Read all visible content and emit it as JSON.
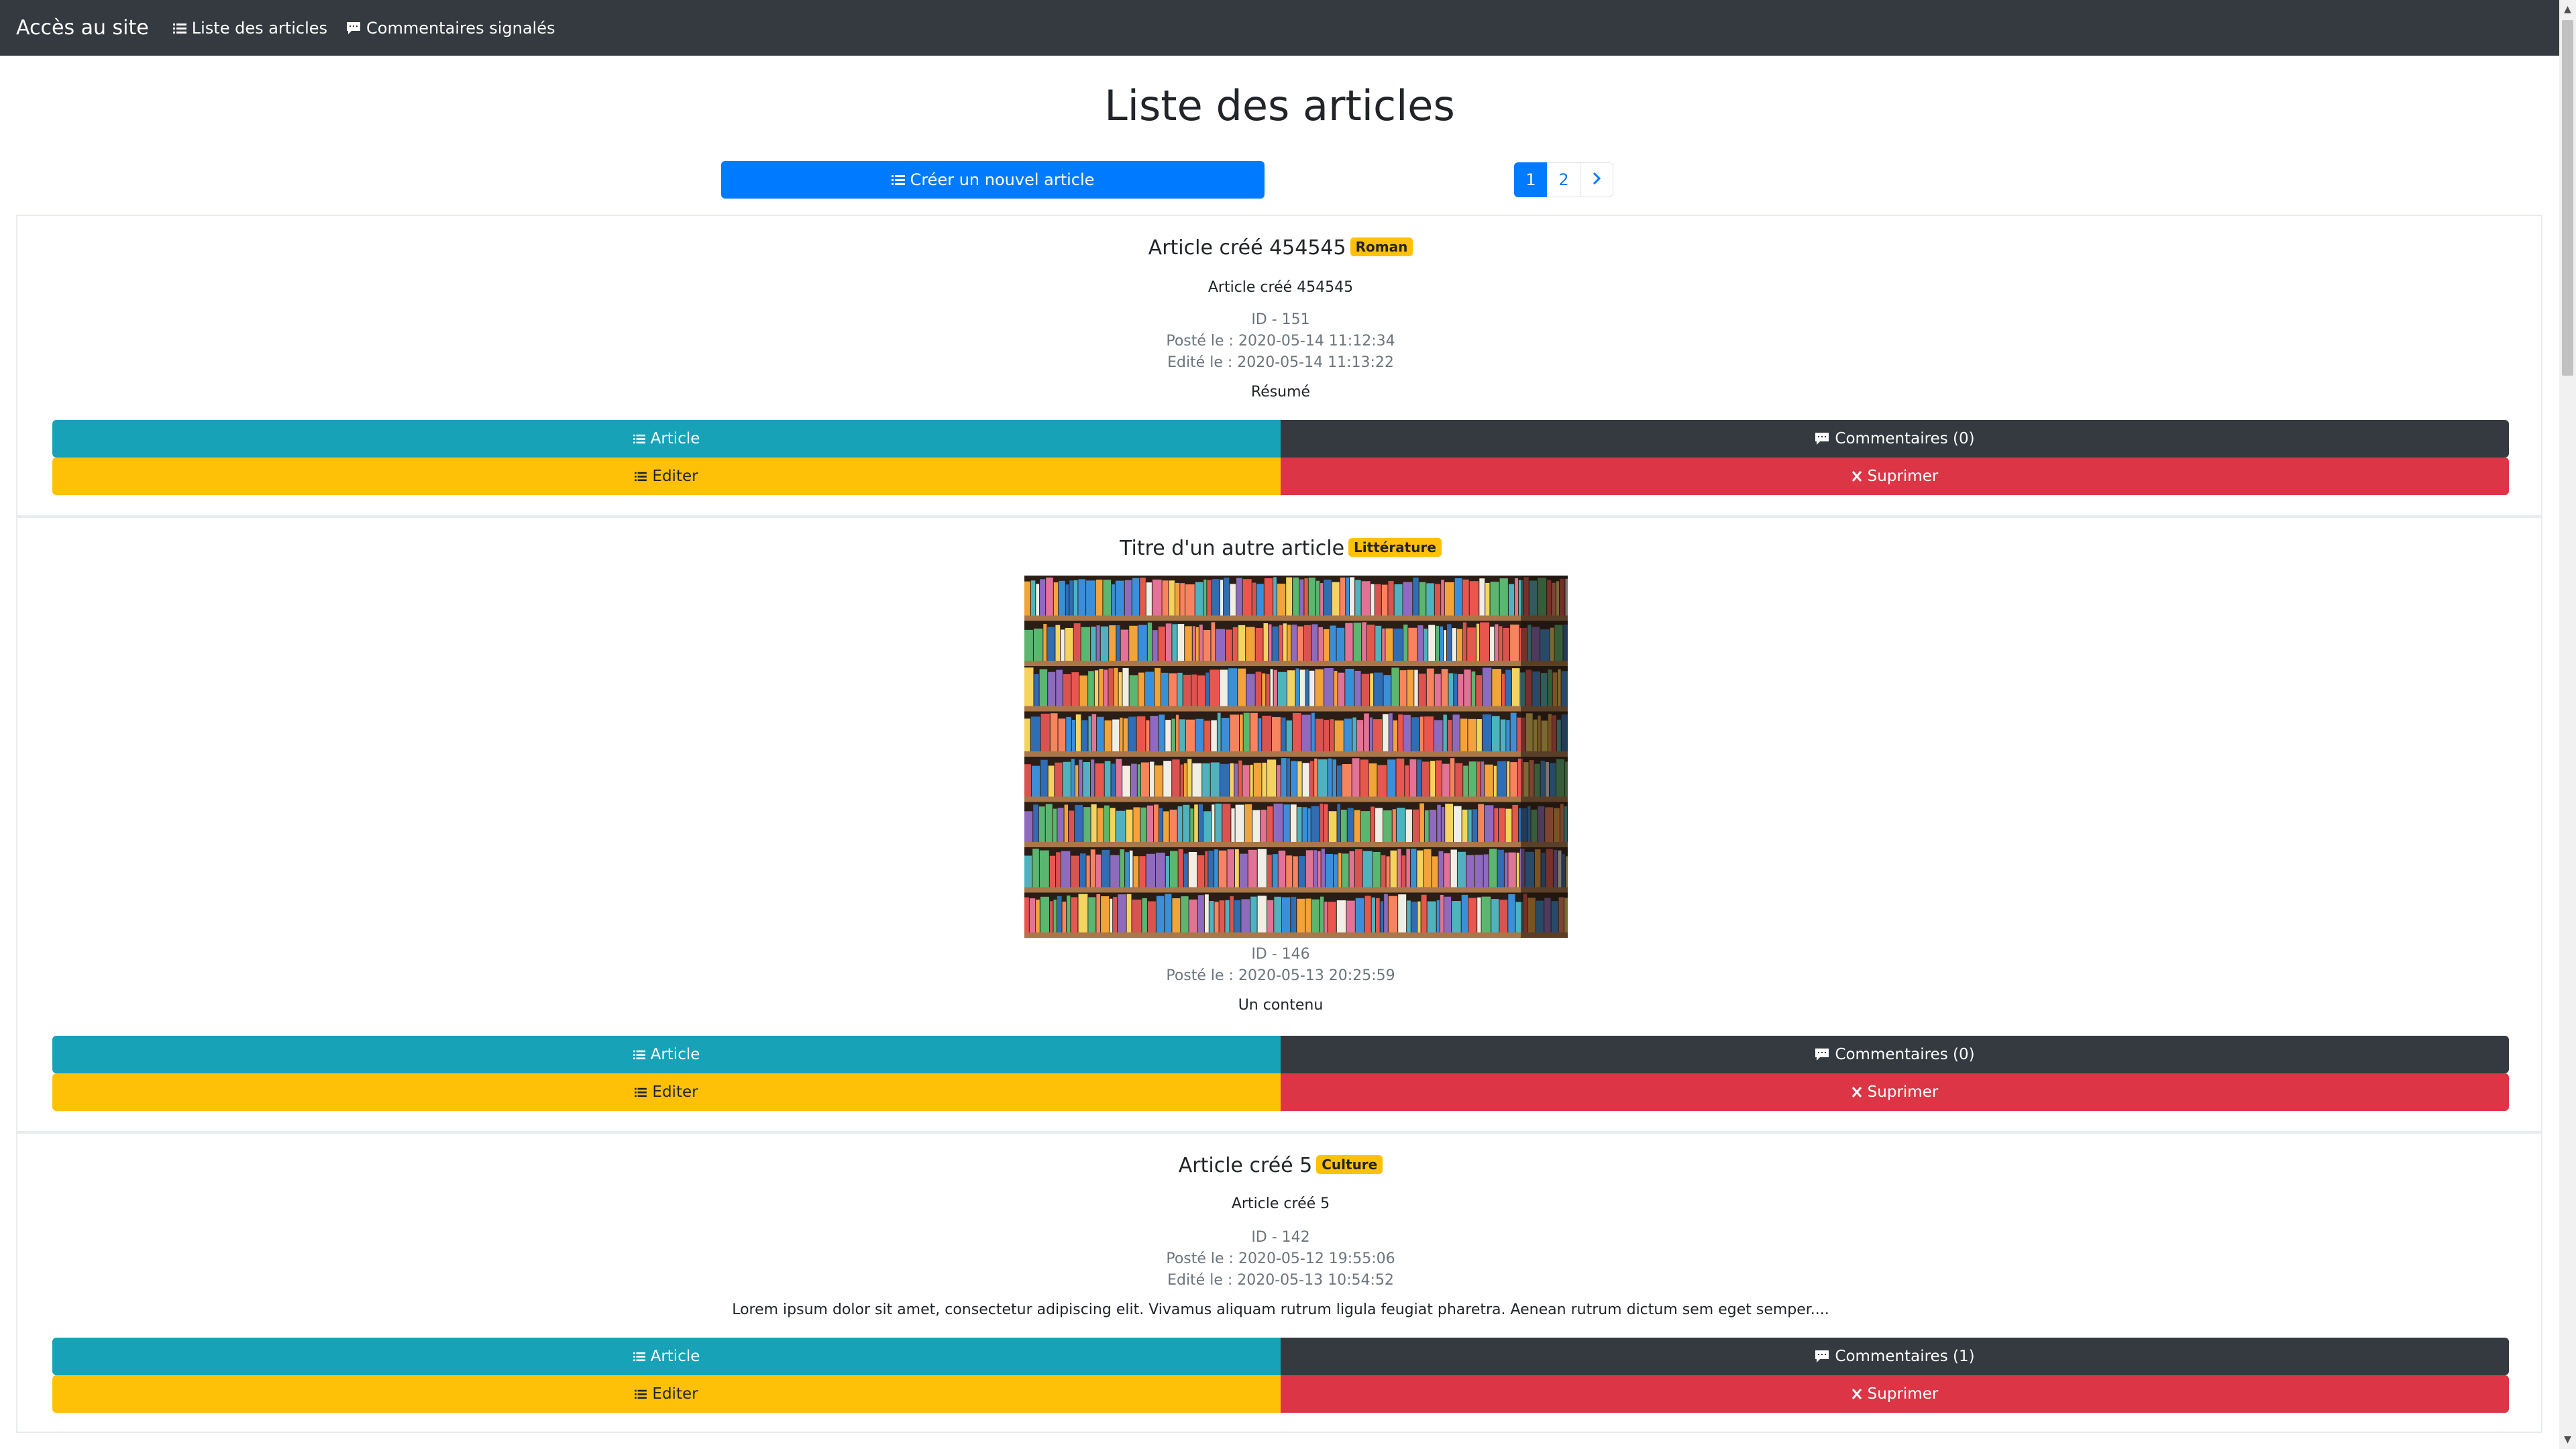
{
  "nav": {
    "brand": "Accès au site",
    "links": [
      {
        "label": "Liste des articles",
        "icon": "list-icon"
      },
      {
        "label": "Commentaires signalés",
        "icon": "comment-icon"
      }
    ]
  },
  "header": {
    "title": "Liste des articles",
    "create_label": "Créer un nouvel article",
    "pages": [
      "1",
      "2"
    ],
    "next_icon": "chevron-right-icon"
  },
  "articles": [
    {
      "title": "Article créé 454545",
      "category": "Roman",
      "subtitle": "Article créé 454545",
      "id": "ID - 151",
      "posted": "Posté le : 2020-05-14 11:12:34",
      "edited": "Edité le : 2020-05-14 11:13:22",
      "content": "Résumé",
      "comments": "Commentaires (0)"
    },
    {
      "title": "Titre d'un autre article",
      "category": "Littérature",
      "image": "bookshelf-image",
      "id": "ID - 146",
      "posted": "Posté le : 2020-05-13 20:25:59",
      "content": "Un contenu",
      "comments": "Commentaires (0)"
    },
    {
      "title": "Article créé 5",
      "category": "Culture",
      "subtitle": "Article créé 5",
      "id": "ID - 142",
      "posted": "Posté le : 2020-05-12 19:55:06",
      "edited": "Edité le : 2020-05-13 10:54:52",
      "content": "Lorem ipsum dolor sit amet, consectetur adipiscing elit. Vivamus aliquam rutrum ligula feugiat pharetra. Aenean rutrum dictum sem eget semper....",
      "comments": "Commentaires (1)"
    }
  ],
  "buttons": {
    "article": "Article",
    "edit": "Editer",
    "delete": "Suprimer"
  },
  "colors": {
    "navbar": "#343a40",
    "primary": "#007bff",
    "info": "#17a2b8",
    "warning": "#ffc107",
    "danger": "#dc3545",
    "dark": "#343a40"
  }
}
